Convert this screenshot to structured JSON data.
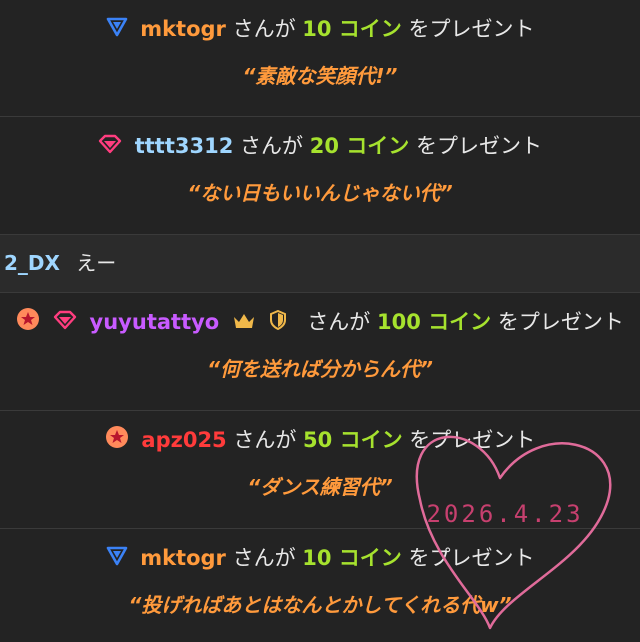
{
  "colors": {
    "background": "#232323",
    "amount": "#a6e22e",
    "quote": "#ff9a3c",
    "heart": "#e06b9a",
    "date": "#c7406f"
  },
  "verb_text": "さんが",
  "gift_text": "をプレゼント",
  "gifts": [
    {
      "user": "mktogr",
      "user_color": "#ff9a3c",
      "badges": [
        "triangle-down-icon"
      ],
      "amount": "10 コイン",
      "message": "“素敵な笑顔代!”"
    },
    {
      "user": "tttt3312",
      "user_color": "#9fd6ff",
      "badges": [
        "gem-icon"
      ],
      "amount": "20 コイン",
      "message": "“ない日もいいんじゃない代”"
    },
    {
      "user": "yuyutattyo",
      "user_color": "#c85bff",
      "badges": [
        "star-badge-icon",
        "gem-icon"
      ],
      "suffix_icons": [
        "crown-icon",
        "shield-icon"
      ],
      "amount": "100 コイン",
      "message": "“何を送れば分からん代”"
    },
    {
      "user": "apz025",
      "user_color": "#ff3b3b",
      "badges": [
        "star-badge-icon"
      ],
      "amount": "50 コイン",
      "message": "“ダンス練習代”"
    },
    {
      "user": "mktogr",
      "user_color": "#ff9a3c",
      "badges": [
        "triangle-down-icon"
      ],
      "amount": "10 コイン",
      "message": "“投げればあとはなんとかしてくれる代w”"
    }
  ],
  "chat_message": {
    "user": "2_DX",
    "text": "えー"
  },
  "overlay": {
    "date": "2026.4.23"
  }
}
